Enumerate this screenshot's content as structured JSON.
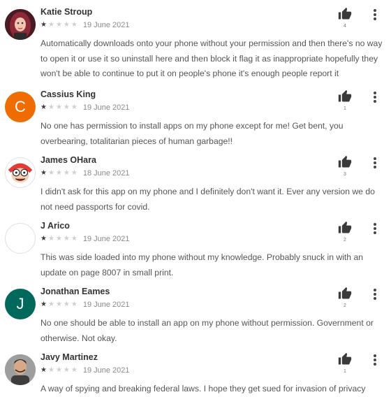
{
  "reviews": [
    {
      "name": "Katie Stroup",
      "rating": 1,
      "date": "19 June 2021",
      "text": "Automatically downloads onto your phone without your permission and then there's no way to open it or use it so uninstall here and then block it flag it as inappropriate hopefully they won't be able to continue to put it on people's phone it's enough people report it",
      "likes": "4",
      "avatar": {
        "type": "photo",
        "color": "#b03a48"
      }
    },
    {
      "name": "Cassius King",
      "rating": 1,
      "date": "19 June 2021",
      "text": "No one has permission to install apps on my phone except for me! Get bent, you overbearing, totalitarian pieces of human garbage!!",
      "likes": "1",
      "avatar": {
        "type": "initial",
        "initial": "C",
        "color": "#ef6c00"
      }
    },
    {
      "name": "James OHara",
      "rating": 1,
      "date": "18 June 2021",
      "text": "I didn't ask for this app on my phone and I definitely don't want it. Ever any version we do not need passports for covid.",
      "likes": "3",
      "avatar": {
        "type": "cartoon",
        "color": "#c62828"
      }
    },
    {
      "name": "J Arico",
      "rating": 1,
      "date": "19 June 2021",
      "text": "This was side loaded into my phone without my knowledge. Probably snuck in with an update on page 8007 in small print.",
      "likes": "2",
      "avatar": {
        "type": "blank",
        "color": "#ffffff"
      }
    },
    {
      "name": "Jonathan Eames",
      "rating": 1,
      "date": "19 June 2021",
      "text": "No one should be able to install an app on my phone without permission. Government or otherwise. Not okay.",
      "likes": "2",
      "avatar": {
        "type": "initial",
        "initial": "J",
        "color": "#00695c"
      }
    },
    {
      "name": "Javy Martinez",
      "rating": 1,
      "date": "19 June 2021",
      "text": "A way of spying and breaking federal laws. I hope they get sued for invasion of privacy",
      "likes": "1",
      "avatar": {
        "type": "photo",
        "color": "#6d6d6d"
      }
    }
  ],
  "icons": {
    "like": "thumbs-up-icon",
    "more": "more-vert-icon",
    "star": "star-icon"
  }
}
